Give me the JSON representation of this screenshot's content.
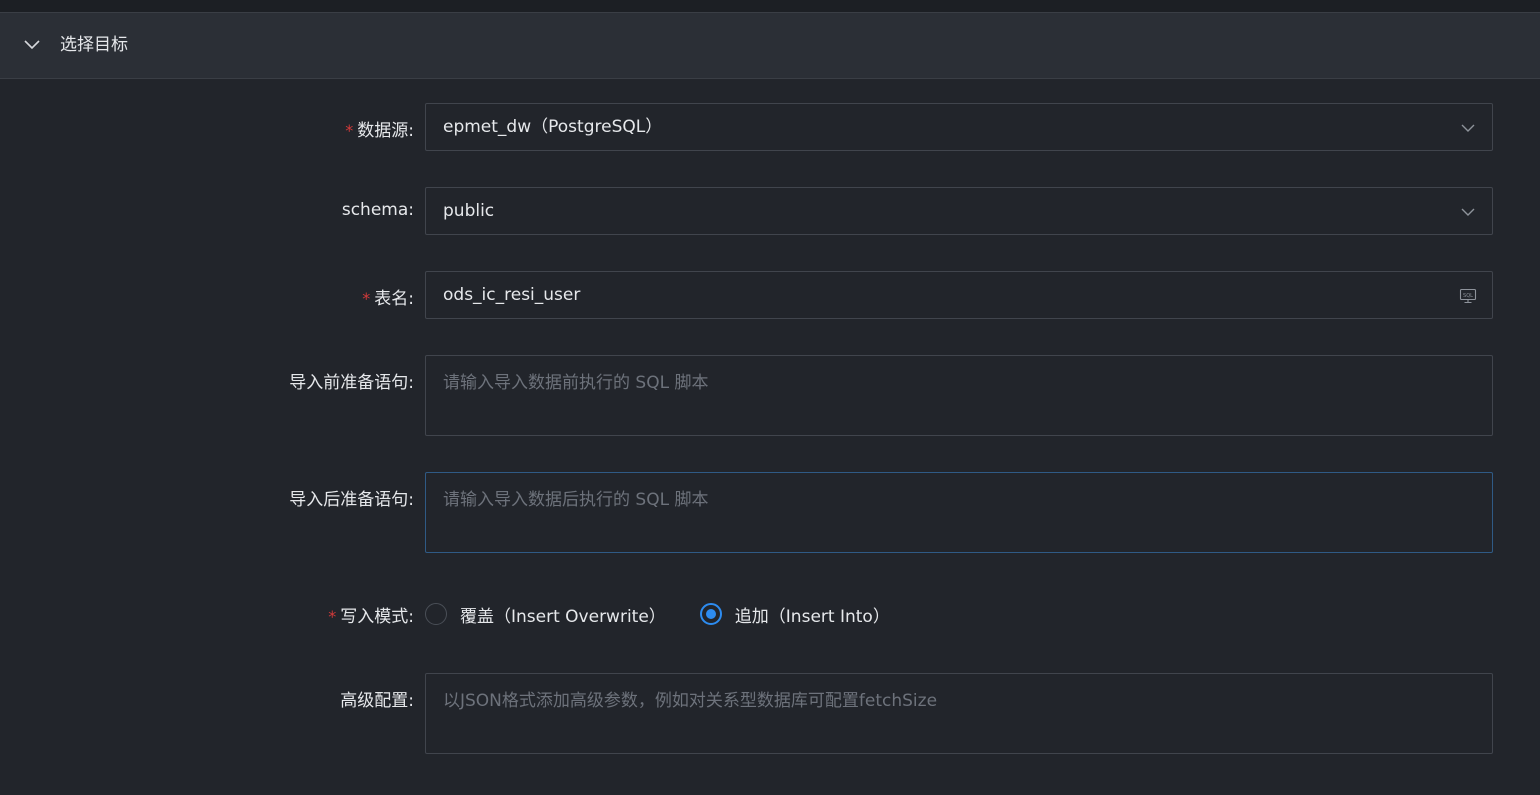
{
  "section": {
    "title": "选择目标",
    "toggle_icon": "chevron-down-icon"
  },
  "colors": {
    "background": "#22252b",
    "header": "#2b2f36",
    "required": "#d33a3a",
    "accent": "#2d8cf0"
  },
  "fields": {
    "datasource": {
      "label": "数据源:",
      "required": true,
      "value": "epmet_dw（PostgreSQL）",
      "icon": "chevron-down-icon"
    },
    "schema": {
      "label": "schema:",
      "required": false,
      "value": "public",
      "icon": "chevron-down-icon"
    },
    "table": {
      "label": "表名:",
      "required": true,
      "value": "ods_ic_resi_user",
      "icon": "sql-icon"
    },
    "pre_sql": {
      "label": "导入前准备语句:",
      "placeholder": "请输入导入数据前执行的 SQL 脚本"
    },
    "post_sql": {
      "label": "导入后准备语句:",
      "placeholder": "请输入导入数据后执行的 SQL 脚本"
    },
    "write_mode": {
      "label": "写入模式:",
      "required": true,
      "options": [
        {
          "label": "覆盖（Insert Overwrite）",
          "checked": false
        },
        {
          "label": "追加（Insert Into）",
          "checked": true
        }
      ]
    },
    "advanced": {
      "label": "高级配置:",
      "placeholder": "以JSON格式添加高级参数，例如对关系型数据库可配置fetchSize"
    }
  }
}
